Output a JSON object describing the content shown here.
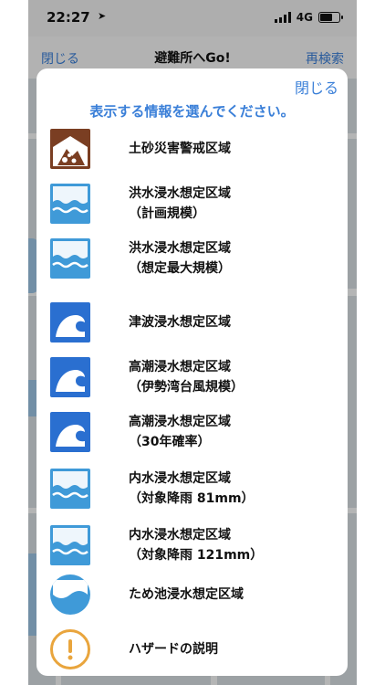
{
  "status": {
    "time": "22:27",
    "location_arrow": "➤",
    "network": "4G"
  },
  "navbar": {
    "close": "閉じる",
    "title": "避難所へGo!",
    "research": "再検索"
  },
  "sheet": {
    "close": "閉じる",
    "heading": "表示する情報を選んでください。",
    "items": [
      {
        "icon": "landslide-icon",
        "lines": [
          "土砂災害警戒区域"
        ]
      },
      {
        "icon": "flood-icon",
        "lines": [
          "洪水浸水想定区域",
          "（計画規模）"
        ]
      },
      {
        "icon": "flood-icon",
        "lines": [
          "洪水浸水想定区域",
          "（想定最大規模）"
        ]
      },
      {
        "icon": "tsunami-icon",
        "lines": [
          "津波浸水想定区域"
        ]
      },
      {
        "icon": "tsunami-icon",
        "lines": [
          "高潮浸水想定区域",
          "（伊勢湾台風規模）"
        ]
      },
      {
        "icon": "tsunami-icon",
        "lines": [
          "高潮浸水想定区域",
          "（30年確率）"
        ]
      },
      {
        "icon": "flood-icon",
        "lines": [
          "内水浸水想定区域",
          "（対象降雨 81mm）"
        ]
      },
      {
        "icon": "flood-icon",
        "lines": [
          "内水浸水想定区域",
          "（対象降雨 121mm）"
        ]
      },
      {
        "icon": "pond-icon",
        "lines": [
          "ため池浸水想定区域"
        ]
      },
      {
        "icon": "info-icon",
        "lines": [
          "ハザードの説明"
        ]
      }
    ]
  },
  "colors": {
    "accent": "#3a7fd8",
    "flood": "#3f9ad8",
    "tsunami": "#2a6fd0",
    "landslide": "#7a3e22",
    "info": "#e9a53d"
  }
}
